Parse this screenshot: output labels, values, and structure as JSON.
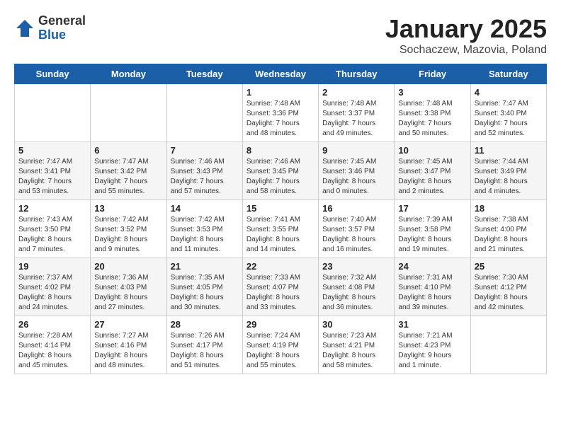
{
  "header": {
    "logo_line1": "General",
    "logo_line2": "Blue",
    "month": "January 2025",
    "location": "Sochaczew, Mazovia, Poland"
  },
  "weekdays": [
    "Sunday",
    "Monday",
    "Tuesday",
    "Wednesday",
    "Thursday",
    "Friday",
    "Saturday"
  ],
  "weeks": [
    [
      {
        "day": "",
        "info": ""
      },
      {
        "day": "",
        "info": ""
      },
      {
        "day": "",
        "info": ""
      },
      {
        "day": "1",
        "info": "Sunrise: 7:48 AM\nSunset: 3:36 PM\nDaylight: 7 hours\nand 48 minutes."
      },
      {
        "day": "2",
        "info": "Sunrise: 7:48 AM\nSunset: 3:37 PM\nDaylight: 7 hours\nand 49 minutes."
      },
      {
        "day": "3",
        "info": "Sunrise: 7:48 AM\nSunset: 3:38 PM\nDaylight: 7 hours\nand 50 minutes."
      },
      {
        "day": "4",
        "info": "Sunrise: 7:47 AM\nSunset: 3:40 PM\nDaylight: 7 hours\nand 52 minutes."
      }
    ],
    [
      {
        "day": "5",
        "info": "Sunrise: 7:47 AM\nSunset: 3:41 PM\nDaylight: 7 hours\nand 53 minutes."
      },
      {
        "day": "6",
        "info": "Sunrise: 7:47 AM\nSunset: 3:42 PM\nDaylight: 7 hours\nand 55 minutes."
      },
      {
        "day": "7",
        "info": "Sunrise: 7:46 AM\nSunset: 3:43 PM\nDaylight: 7 hours\nand 57 minutes."
      },
      {
        "day": "8",
        "info": "Sunrise: 7:46 AM\nSunset: 3:45 PM\nDaylight: 7 hours\nand 58 minutes."
      },
      {
        "day": "9",
        "info": "Sunrise: 7:45 AM\nSunset: 3:46 PM\nDaylight: 8 hours\nand 0 minutes."
      },
      {
        "day": "10",
        "info": "Sunrise: 7:45 AM\nSunset: 3:47 PM\nDaylight: 8 hours\nand 2 minutes."
      },
      {
        "day": "11",
        "info": "Sunrise: 7:44 AM\nSunset: 3:49 PM\nDaylight: 8 hours\nand 4 minutes."
      }
    ],
    [
      {
        "day": "12",
        "info": "Sunrise: 7:43 AM\nSunset: 3:50 PM\nDaylight: 8 hours\nand 7 minutes."
      },
      {
        "day": "13",
        "info": "Sunrise: 7:42 AM\nSunset: 3:52 PM\nDaylight: 8 hours\nand 9 minutes."
      },
      {
        "day": "14",
        "info": "Sunrise: 7:42 AM\nSunset: 3:53 PM\nDaylight: 8 hours\nand 11 minutes."
      },
      {
        "day": "15",
        "info": "Sunrise: 7:41 AM\nSunset: 3:55 PM\nDaylight: 8 hours\nand 14 minutes."
      },
      {
        "day": "16",
        "info": "Sunrise: 7:40 AM\nSunset: 3:57 PM\nDaylight: 8 hours\nand 16 minutes."
      },
      {
        "day": "17",
        "info": "Sunrise: 7:39 AM\nSunset: 3:58 PM\nDaylight: 8 hours\nand 19 minutes."
      },
      {
        "day": "18",
        "info": "Sunrise: 7:38 AM\nSunset: 4:00 PM\nDaylight: 8 hours\nand 21 minutes."
      }
    ],
    [
      {
        "day": "19",
        "info": "Sunrise: 7:37 AM\nSunset: 4:02 PM\nDaylight: 8 hours\nand 24 minutes."
      },
      {
        "day": "20",
        "info": "Sunrise: 7:36 AM\nSunset: 4:03 PM\nDaylight: 8 hours\nand 27 minutes."
      },
      {
        "day": "21",
        "info": "Sunrise: 7:35 AM\nSunset: 4:05 PM\nDaylight: 8 hours\nand 30 minutes."
      },
      {
        "day": "22",
        "info": "Sunrise: 7:33 AM\nSunset: 4:07 PM\nDaylight: 8 hours\nand 33 minutes."
      },
      {
        "day": "23",
        "info": "Sunrise: 7:32 AM\nSunset: 4:08 PM\nDaylight: 8 hours\nand 36 minutes."
      },
      {
        "day": "24",
        "info": "Sunrise: 7:31 AM\nSunset: 4:10 PM\nDaylight: 8 hours\nand 39 minutes."
      },
      {
        "day": "25",
        "info": "Sunrise: 7:30 AM\nSunset: 4:12 PM\nDaylight: 8 hours\nand 42 minutes."
      }
    ],
    [
      {
        "day": "26",
        "info": "Sunrise: 7:28 AM\nSunset: 4:14 PM\nDaylight: 8 hours\nand 45 minutes."
      },
      {
        "day": "27",
        "info": "Sunrise: 7:27 AM\nSunset: 4:16 PM\nDaylight: 8 hours\nand 48 minutes."
      },
      {
        "day": "28",
        "info": "Sunrise: 7:26 AM\nSunset: 4:17 PM\nDaylight: 8 hours\nand 51 minutes."
      },
      {
        "day": "29",
        "info": "Sunrise: 7:24 AM\nSunset: 4:19 PM\nDaylight: 8 hours\nand 55 minutes."
      },
      {
        "day": "30",
        "info": "Sunrise: 7:23 AM\nSunset: 4:21 PM\nDaylight: 8 hours\nand 58 minutes."
      },
      {
        "day": "31",
        "info": "Sunrise: 7:21 AM\nSunset: 4:23 PM\nDaylight: 9 hours\nand 1 minute."
      },
      {
        "day": "",
        "info": ""
      }
    ]
  ]
}
